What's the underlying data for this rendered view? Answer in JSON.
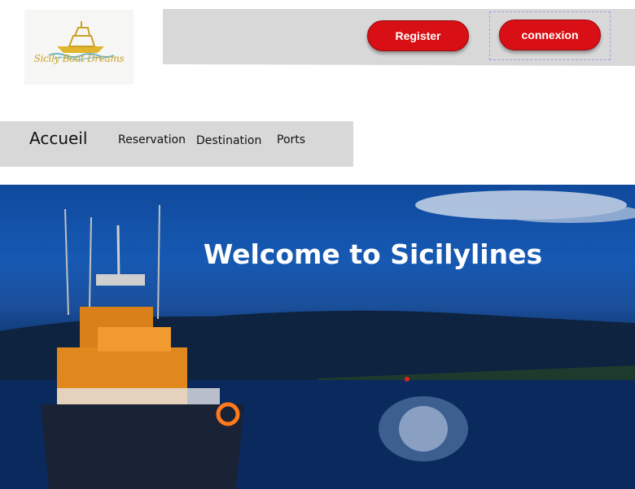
{
  "logo": {
    "text": "Sicily Boat Dreams"
  },
  "header": {
    "register_label": "Register",
    "connexion_label": "connexion"
  },
  "nav": {
    "home": "Accueil",
    "reservation": "Reservation",
    "destination": "Destination",
    "ports": "Ports"
  },
  "hero": {
    "title": "Welcome to Sicilylines"
  },
  "colors": {
    "accent": "#d80f14",
    "bar": "#d8d8d8",
    "logo_gold": "#c9a227"
  }
}
